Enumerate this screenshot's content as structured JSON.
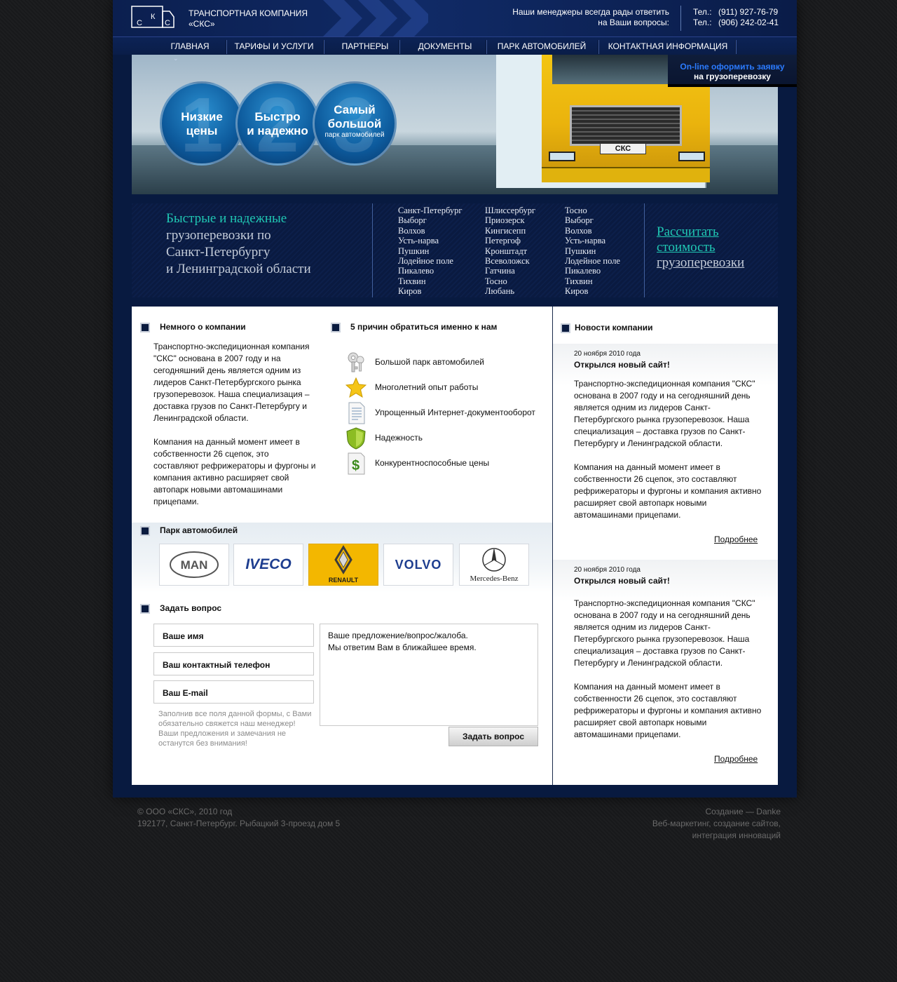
{
  "header": {
    "logo_letters": [
      "С",
      "К",
      "С"
    ],
    "company_line1": "ТРАНСПОРТНАЯ КОМПАНИЯ",
    "company_line2": "«СКС»",
    "msg_line1": "Наши менеджеры всегда рады ответить",
    "msg_line2": "на Ваши вопросы:",
    "phone_label": "Тел.:",
    "phone1": "(911) 927-76-79",
    "phone2": "(906) 242-02-41"
  },
  "nav": {
    "items": [
      "ГЛАВНАЯ",
      "ТАРИФЫ И УСЛУГИ",
      "ПАРТНЕРЫ",
      "ДОКУМЕНТЫ",
      "ПАРК АВТОМОБИЛЕЙ",
      "КОНТАКТНАЯ ИНФОРМАЦИЯ"
    ],
    "active_index": 0
  },
  "online_order": {
    "line1": "On-line оформить заявку",
    "line2": "на грузоперевозку"
  },
  "banner": {
    "plate": "СКС",
    "circles": [
      {
        "num": "1",
        "title_l1": "Низкие",
        "title_l2": "цены",
        "sub": ""
      },
      {
        "num": "2",
        "title_l1": "Быстро",
        "title_l2": "и надежно",
        "sub": ""
      },
      {
        "num": "3",
        "title_l1": "Самый",
        "title_l2": "большой",
        "sub": "парк автомобилей"
      }
    ]
  },
  "slogan": {
    "line1": "Быстрые и надежные",
    "line2": "грузоперевозки по",
    "line3": "Санкт-Петербургу",
    "line4": "и Ленинградской области"
  },
  "cities": {
    "col1": [
      "Санкт-Петербург",
      "Выборг",
      "Волхов",
      "Усть-нарва",
      "Пушкин",
      "Лодейное поле",
      "Пикалево",
      "Тихвин",
      "Киров"
    ],
    "col2": [
      "Шлиссербург",
      "Приозерск",
      "Кингисепп",
      "Петергоф",
      "Кронштадт",
      "Всеволожск",
      "Гатчина",
      "Тосно",
      "Любань"
    ],
    "col3": [
      "Тосно",
      "Выборг",
      "Волхов",
      "Усть-нарва",
      "Пушкин",
      "Лодейное поле",
      "Пикалево",
      "Тихвин",
      "Киров"
    ]
  },
  "calc": {
    "line1": "Рассчитать",
    "line2": "стоимость",
    "line3": "грузоперевозки"
  },
  "about": {
    "title": "Немного о компании",
    "p1": "Транспортно-экспедиционная компания \"СКС\" основана в 2007 году и на сегодняшний день является одним из лидеров Санкт-Петербургского рынка грузоперевозок. Наша специализация – доставка грузов по Санкт-Петербургу и Ленинградской области.",
    "p2": "Компания на данный момент имеет в собственности 26 сцепок, это составляют рефрижераторы и фургоны и компания активно расширяет свой автопарк новыми автомашинами прицепами."
  },
  "reasons": {
    "title": "5 причин обратиться именно к нам",
    "items": [
      {
        "label": "Большой парк автомобилей",
        "icon": "keys-icon"
      },
      {
        "label": "Многолетний опыт работы",
        "icon": "star-icon"
      },
      {
        "label": "Упрощенный Интернет-документооборот",
        "icon": "document-icon"
      },
      {
        "label": "Надежность",
        "icon": "shield-icon"
      },
      {
        "label": "Конкурентноспособные цены",
        "icon": "dollar-icon"
      }
    ]
  },
  "park": {
    "title": "Парк автомобилей",
    "brands": [
      "MAN",
      "IVECO",
      "RENAULT",
      "VOLVO",
      "Mercedes-Benz"
    ]
  },
  "question": {
    "title": "Задать вопрос",
    "name_field": "Ваше имя",
    "phone_field": "Ваш контактный телефон",
    "email_field": "Ваш E-mail",
    "textarea_l1": "Ваше предложение/вопрос/жалоба.",
    "textarea_l2": "Мы ответим Вам в ближайшее время.",
    "note": "Заполнив все поля данной формы, с Вами обязательно свяжется наш менеджер! Ваши предложения и замечания не останутся без внимания!",
    "submit": "Задать вопрос"
  },
  "news": {
    "title": "Новости компании",
    "items": [
      {
        "date": "20 ноября 2010 года",
        "headline": "Открылся новый сайт!",
        "p1": "Транспортно-экспедиционная компания \"СКС\" основана в 2007 году и на сегодняшний день является одним из лидеров Санкт-Петербургского рынка грузоперевозок. Наша специализация – доставка грузов по Санкт-Петербургу и Ленинградской области.",
        "p2": "Компания на данный момент имеет в собственности 26 сцепок, это составляют рефрижераторы и фургоны и компания активно расширяет свой автопарк новыми автомашинами прицепами.",
        "more": "Подробнее"
      },
      {
        "date": "20 ноября 2010 года",
        "headline": "Открылся новый сайт!",
        "p1": "Транспортно-экспедиционная компания \"СКС\" основана в 2007 году и на сегодняшний день является одним из лидеров Санкт-Петербургского рынка грузоперевозок. Наша специализация – доставка грузов по Санкт-Петербургу и Ленинградской области.",
        "p2": "Компания на данный момент имеет в собственности 26 сцепок, это составляют рефрижераторы и фургоны и компания активно расширяет свой автопарк новыми автомашинами прицепами.",
        "more": "Подробнее"
      }
    ]
  },
  "footer": {
    "copyright": "© ООО «СКС», 2010 год",
    "address": "192177, Санкт-Петербург. Рыбацкий 3-проезд  дом 5",
    "credit_line1": "Создание  —  Danke",
    "credit_line2": "Веб-маркетинг, создание сайтов,",
    "credit_line3": "интеграция инноваций"
  },
  "colors": {
    "accent_teal": "#20c7b3",
    "online_blue": "#2b7bff",
    "frame_navy": "#081a40"
  }
}
